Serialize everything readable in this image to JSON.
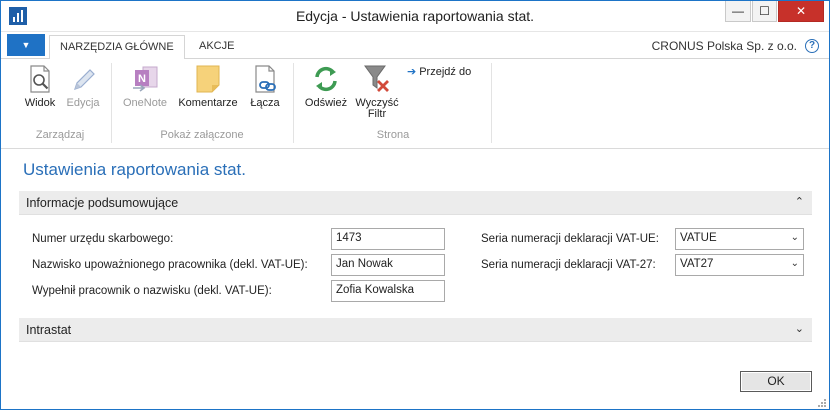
{
  "window": {
    "title": "Edycja - Ustawienia raportowania stat.",
    "minimize": "—",
    "maximize": "☐",
    "close": "✕"
  },
  "ribbon_tabs": {
    "menu": "▼",
    "home": "NARZĘDZIA GŁÓWNE",
    "actions": "AKCJE",
    "company": "CRONUS Polska Sp. z o.o.",
    "help": "?"
  },
  "ribbon": {
    "view": "Widok",
    "edit": "Edycja",
    "onenote": "OneNote",
    "comments": "Komentarze",
    "links": "Łącza",
    "refresh": "Odśwież",
    "clear_filter_1": "Wyczyść",
    "clear_filter_2": "Filtr",
    "goto": "Przejdź do",
    "group_manage": "Zarządzaj",
    "group_attachments": "Pokaż załączone",
    "group_page": "Strona"
  },
  "page": {
    "title": "Ustawienia raportowania stat."
  },
  "summary": {
    "header": "Informacje podsumowujące",
    "chevron": "⌃",
    "tax_office_label": "Numer urzędu skarbowego:",
    "tax_office_value": "1473",
    "authorized_label": "Nazwisko upoważnionego pracownika (dekl. VAT-UE):",
    "authorized_value": "Jan Nowak",
    "filled_by_label": "Wypełnił pracownik o nazwisku (dekl. VAT-UE):",
    "filled_by_value": "Zofia Kowalska",
    "vatue_series_label": "Seria numeracji deklaracji VAT-UE:",
    "vatue_series_value": "VATUE",
    "vat27_series_label": "Seria numeracji deklaracji VAT-27:",
    "vat27_series_value": "VAT27"
  },
  "intrastat": {
    "header": "Intrastat",
    "chevron": "⌄"
  },
  "footer": {
    "ok": "OK"
  },
  "colors": {
    "accent": "#1f72c5",
    "title_blue": "#2a6fb8",
    "close_red": "#c7312a"
  }
}
